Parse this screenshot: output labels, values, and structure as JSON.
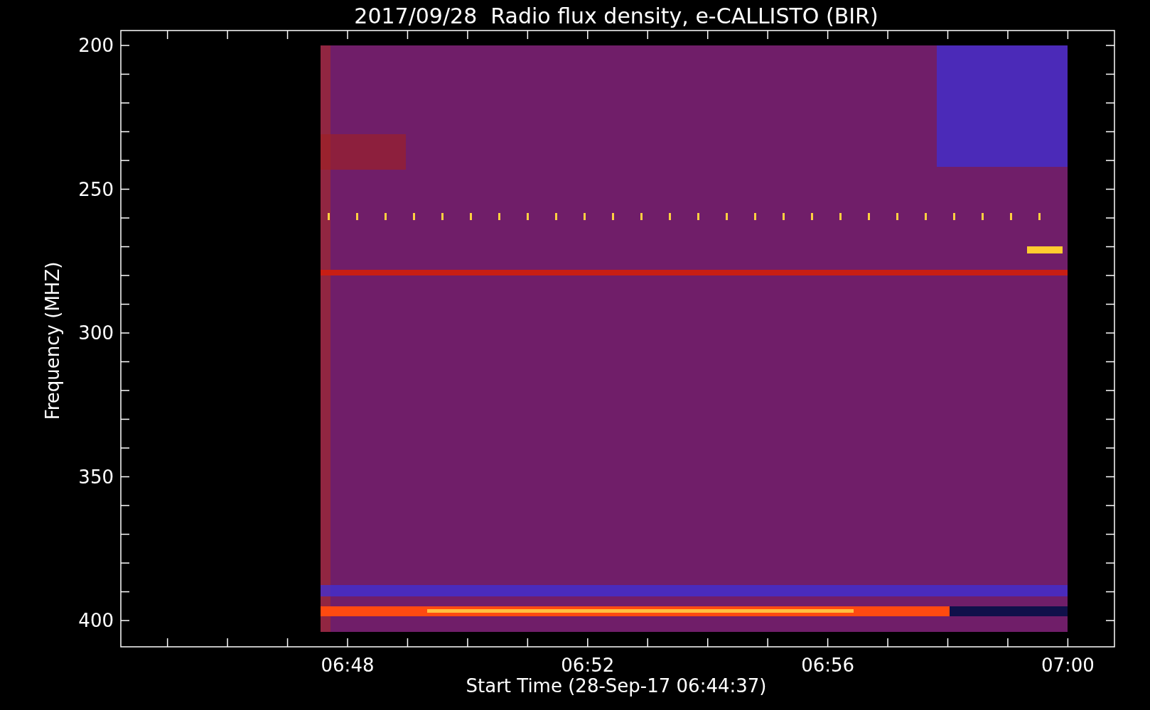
{
  "title": "2017/09/28  Radio flux density, e-CALLISTO (BIR)",
  "y_axis": {
    "label": "Frequency (MHZ)",
    "ticks": [
      "200",
      "250",
      "300",
      "350",
      "400"
    ]
  },
  "x_axis": {
    "label": "Start Time (28-Sep-17 06:44:37)",
    "ticks": [
      "06:48",
      "06:52",
      "06:56",
      "07:00"
    ]
  }
}
